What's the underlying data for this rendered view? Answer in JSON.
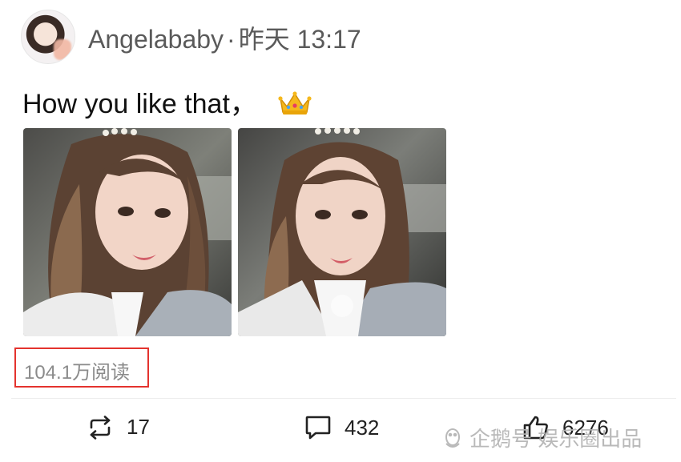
{
  "post": {
    "author": "Angelababy",
    "separator": "·",
    "time": "昨天 13:17",
    "text": "How you like that，",
    "emoji_icon": "crown-icon",
    "reads": "104.1万阅读"
  },
  "actions": {
    "repost_count": "17",
    "comment_count": "432",
    "like_count": "6276"
  },
  "watermark": {
    "text": "企鹅号 娱乐圈出品"
  },
  "colors": {
    "highlight_box": "#e4332e",
    "meta_text": "#8b8b8b",
    "author_text": "#5a5a5a"
  }
}
